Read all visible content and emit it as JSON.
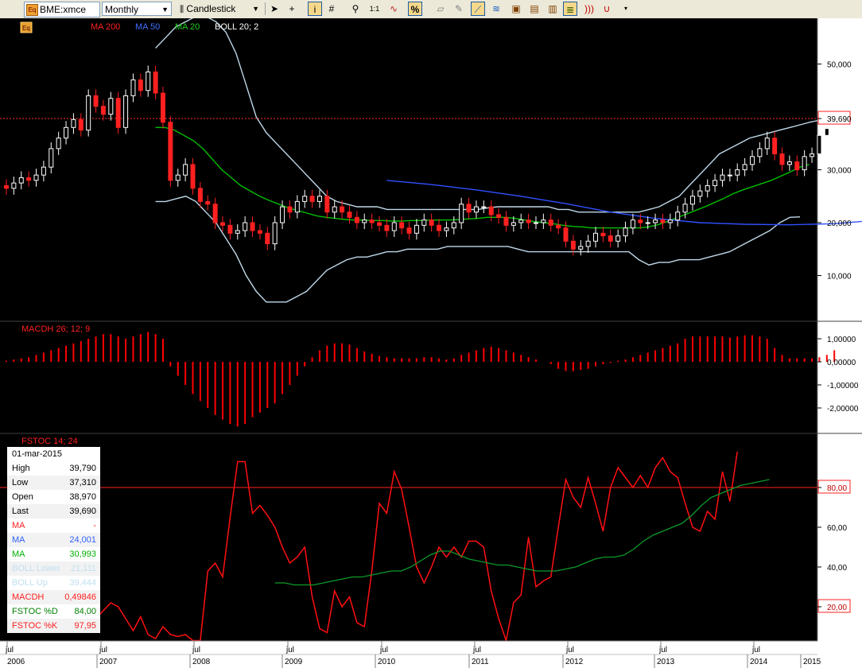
{
  "toolbar": {
    "symbol": "BME:xmce",
    "period": "Monthly",
    "chart_type": "Candlestick",
    "icons": [
      "pointer-icon",
      "crosshair-icon",
      "info-icon",
      "grid-icon",
      "zoom-icon",
      "one-to-one-icon",
      "wave-icon",
      "percent-icon",
      "eraser-icon",
      "pen-icon",
      "line-tool-icon",
      "fibonacci-icon",
      "marker-icon",
      "text-icon",
      "channel-icon",
      "sound-icon",
      "magnet-icon"
    ]
  },
  "legend": {
    "eq_label": "Eq",
    "ma200": "MA 200",
    "ma50": "MA 50",
    "ma20": "MA 20",
    "boll": "BOLL 20; 2",
    "macdh": "MACDH 26; 12; 9",
    "fstoc": "FSTOC 14; 24"
  },
  "colors": {
    "candle_up": "#ffffff",
    "candle_down": "#ff2020",
    "ma50": "#3050ff",
    "ma20": "#00c000",
    "bollinger": "#c0d8e8",
    "macd": "#ff0000",
    "stoch_k": "#ff1010",
    "stoch_d": "#0a9a2a",
    "last_line": "#ff3030"
  },
  "price_axis": [
    "50,000",
    "40,000",
    "30,000",
    "20,000",
    "10,000"
  ],
  "last_price_label": "39,690",
  "macd_axis": [
    "1,00000",
    "0,00000",
    "-1,00000",
    "-2,00000"
  ],
  "stoch_axis": [
    "80,00",
    "60,00",
    "40,00",
    "20,00"
  ],
  "x_axis": {
    "years": [
      "2006",
      "2007",
      "2008",
      "2009",
      "2010",
      "2011",
      "2012",
      "2013",
      "2014",
      "2015"
    ],
    "jul_label": "jul"
  },
  "info": {
    "date": "01-mar-2015",
    "rows": [
      {
        "k": "High",
        "v": "39,790",
        "color": "#000000"
      },
      {
        "k": "Low",
        "v": "37,310",
        "color": "#000000"
      },
      {
        "k": "Open",
        "v": "38,970",
        "color": "#000000"
      },
      {
        "k": "Last",
        "v": "39,690",
        "color": "#000000"
      },
      {
        "k": "MA",
        "v": "-",
        "color": "#ff2020"
      },
      {
        "k": "MA",
        "v": "24,001",
        "color": "#3060ff"
      },
      {
        "k": "MA",
        "v": "30,993",
        "color": "#00b000"
      },
      {
        "k": "BOLL Lower",
        "v": "21,111",
        "color": "#c0e0f0"
      },
      {
        "k": "BOLL Up",
        "v": "39,444",
        "color": "#c0e0f0"
      },
      {
        "k": "MACDH",
        "v": "0,49846",
        "color": "#ff2020"
      },
      {
        "k": "FSTOC %D",
        "v": "84,00",
        "color": "#008000"
      },
      {
        "k": "FSTOC %K",
        "v": "97,95",
        "color": "#ff2020"
      }
    ]
  },
  "chart_data": [
    {
      "type": "candlestick",
      "x_start": "2006-05",
      "frequency": "monthly",
      "close": [
        26.5,
        27.5,
        28.5,
        28.0,
        29.0,
        30.5,
        34.0,
        36.0,
        38.0,
        39.5,
        37.5,
        44.0,
        42.0,
        40.5,
        43.5,
        38.0,
        44.0,
        47.0,
        45.0,
        48.5,
        44.5,
        39.0,
        28.0,
        29.0,
        31.0,
        26.5,
        24.0,
        23.5,
        20.0,
        19.5,
        18.0,
        18.5,
        20.0,
        18.5,
        18.0,
        16.0,
        20.0,
        23.0,
        22.0,
        24.0,
        25.0,
        24.0,
        25.0,
        22.0,
        23.0,
        22.0,
        21.0,
        20.0,
        20.5,
        20.0,
        19.5,
        18.5,
        20.0,
        19.0,
        18.0,
        19.5,
        20.5,
        19.5,
        18.5,
        19.0,
        20.0,
        23.5,
        22.0,
        23.0,
        23.0,
        21.5,
        21.0,
        19.5,
        20.0,
        20.5,
        20.0,
        20.0,
        20.5,
        19.5,
        19.0,
        16.5,
        15.0,
        15.5,
        16.5,
        18.0,
        17.5,
        16.5,
        17.5,
        19.0,
        20.5,
        20.0,
        20.0,
        20.5,
        20.0,
        20.5,
        22.0,
        23.5,
        25.0,
        26.0,
        27.0,
        28.0,
        29.0,
        29.0,
        30.0,
        31.0,
        32.5,
        34.0,
        36.0,
        33.0,
        31.0,
        31.5,
        30.0,
        32.5,
        33.0,
        36.5,
        37.8,
        39.69
      ],
      "open": [
        27.0,
        26.5,
        27.5,
        28.5,
        28.0,
        29.0,
        30.5,
        34.0,
        36.0,
        38.0,
        39.5,
        37.5,
        44.0,
        42.0,
        40.5,
        43.5,
        38.0,
        44.0,
        47.0,
        45.0,
        48.5,
        44.5,
        39.0,
        28.0,
        29.0,
        31.0,
        26.5,
        24.0,
        23.5,
        20.0,
        19.5,
        18.0,
        18.5,
        20.0,
        18.5,
        18.0,
        16.0,
        20.0,
        23.0,
        22.0,
        24.0,
        25.0,
        24.0,
        25.0,
        22.0,
        23.0,
        22.0,
        21.0,
        20.0,
        20.5,
        20.0,
        19.5,
        18.5,
        20.0,
        19.0,
        18.0,
        19.5,
        20.5,
        19.5,
        18.5,
        19.0,
        20.0,
        23.5,
        22.0,
        23.0,
        23.0,
        21.5,
        21.0,
        19.5,
        20.0,
        20.5,
        20.0,
        20.0,
        20.5,
        19.5,
        19.0,
        16.5,
        15.0,
        15.5,
        16.5,
        18.0,
        17.5,
        16.5,
        17.5,
        19.0,
        20.5,
        20.0,
        20.0,
        20.5,
        20.0,
        20.5,
        22.0,
        23.5,
        25.0,
        26.0,
        27.0,
        28.0,
        29.0,
        29.0,
        30.0,
        31.0,
        32.5,
        34.0,
        36.0,
        33.0,
        31.0,
        31.5,
        30.0,
        32.5,
        33.0,
        36.5,
        38.97
      ],
      "ma50": {
        "start_index": 48,
        "values_every_6": [
          28.0,
          27.2,
          26.2,
          25.0,
          23.6,
          22.0,
          20.8,
          20.0,
          19.7,
          19.6,
          19.8,
          20.5,
          21.6,
          22.7,
          23.5,
          24.0
        ]
      },
      "ma20": [
        38,
        38,
        37.5,
        36.5,
        35.5,
        34,
        32,
        30,
        28.5,
        27,
        26,
        25,
        24.2,
        23.5,
        22.8,
        22.3,
        21.8,
        21.3,
        21,
        20.8,
        20.6,
        20.5,
        20.5,
        20.4,
        20.4,
        20.3,
        20.3,
        20.4,
        20.4,
        20.5,
        20.5,
        20.5,
        20.6,
        20.7,
        20.8,
        21,
        21.0,
        21.0,
        20.8,
        20.5,
        20.2,
        20.0,
        19.8,
        19.5,
        19.3,
        19.2,
        19.0,
        19.0,
        19.0,
        19.0,
        19.0,
        19.0,
        19.2,
        19.6,
        20.2,
        20.9,
        21.6,
        22.3,
        23.0,
        23.8,
        24.6,
        25.5,
        26.2,
        26.8,
        27.4,
        28.0,
        28.8,
        29.6,
        30.5,
        31.0
      ],
      "boll_upper": [
        53,
        55,
        57,
        58,
        59,
        59,
        58,
        56,
        52,
        46,
        40,
        37,
        35,
        33,
        31,
        29,
        27,
        25,
        24,
        23.5,
        23,
        23,
        23,
        22.5,
        22.5,
        22.5,
        22.5,
        22.5,
        22.5,
        22.5,
        22.5,
        22.5,
        22.5,
        22.8,
        23,
        23,
        23,
        23,
        23,
        23,
        22.5,
        22.5,
        22,
        22,
        22,
        22,
        22,
        22,
        22,
        22.5,
        23,
        24,
        25,
        27,
        29,
        31,
        33,
        34,
        35,
        36,
        36.5,
        37,
        37.5,
        38,
        38.5,
        39,
        39.4
      ],
      "boll_lower": [
        24,
        24,
        24.5,
        25,
        24,
        22,
        20,
        17,
        14,
        10,
        7,
        5,
        5,
        5,
        6,
        7,
        9,
        11,
        12,
        13,
        13.5,
        13.5,
        14,
        14.5,
        14.5,
        15,
        15,
        15,
        15,
        15.5,
        15.5,
        15.5,
        15.5,
        15.5,
        15.5,
        15.5,
        15,
        14.5,
        14.5,
        14.5,
        14.5,
        14.5,
        14.5,
        14.5,
        14.5,
        14.5,
        14.5,
        14.5,
        13,
        12,
        12.5,
        12.5,
        13,
        13,
        13,
        13.5,
        14,
        14.5,
        15.5,
        16.5,
        17.5,
        18.5,
        20,
        21,
        21.1
      ],
      "ylim": [
        0,
        55
      ],
      "last": 39.69
    },
    {
      "type": "bar",
      "title": "MACDH 26; 12; 9",
      "values": [
        0.05,
        0.1,
        0.15,
        0.2,
        0.3,
        0.4,
        0.5,
        0.6,
        0.7,
        0.8,
        0.9,
        1.0,
        1.1,
        1.2,
        1.2,
        1.1,
        1.0,
        1.1,
        1.2,
        1.3,
        1.2,
        1.0,
        -0.2,
        -0.6,
        -1.0,
        -1.4,
        -1.7,
        -2.0,
        -2.3,
        -2.5,
        -2.7,
        -2.8,
        -2.7,
        -2.4,
        -2.2,
        -2.0,
        -1.8,
        -1.4,
        -1.0,
        -0.6,
        -0.2,
        0.2,
        0.5,
        0.7,
        0.8,
        0.8,
        0.75,
        0.6,
        0.45,
        0.35,
        0.25,
        0.2,
        0.15,
        0.15,
        0.15,
        0.15,
        0.2,
        0.2,
        0.15,
        0.1,
        0.15,
        0.3,
        0.4,
        0.5,
        0.6,
        0.65,
        0.6,
        0.5,
        0.4,
        0.3,
        0.2,
        0.1,
        0.0,
        -0.1,
        -0.3,
        -0.4,
        -0.4,
        -0.35,
        -0.3,
        -0.2,
        -0.1,
        -0.05,
        0.05,
        0.1,
        0.2,
        0.3,
        0.4,
        0.5,
        0.6,
        0.7,
        0.8,
        1.0,
        1.1,
        1.1,
        1.1,
        1.1,
        1.1,
        1.05,
        1.1,
        1.15,
        1.15,
        1.1,
        1.0,
        0.6,
        0.3,
        0.15,
        0.15,
        0.15,
        0.15,
        0.2,
        0.3,
        0.5
      ],
      "ylim": [
        -3,
        1.7
      ]
    },
    {
      "type": "line",
      "title": "FSTOC 14; 24",
      "k": [
        78,
        93,
        90,
        89,
        87,
        62,
        14,
        18,
        22,
        20,
        14,
        8,
        15,
        6,
        4,
        10,
        6,
        5,
        6,
        3,
        3,
        38,
        42,
        35,
        65,
        93,
        93,
        67,
        71,
        66,
        60,
        50,
        42,
        45,
        50,
        25,
        9,
        7,
        28,
        20,
        25,
        12,
        10,
        38,
        72,
        67,
        88,
        79,
        60,
        40,
        32,
        40,
        50,
        45,
        50,
        45,
        53,
        53,
        50,
        28,
        14,
        3,
        22,
        26,
        55,
        30,
        33,
        35,
        60,
        84,
        75,
        70,
        85,
        72,
        58,
        80,
        90,
        85,
        80,
        86,
        80,
        90,
        95,
        88,
        85,
        72,
        60,
        58,
        68,
        64,
        88,
        73,
        97.95
      ],
      "d": [
        32,
        32,
        31,
        31,
        31,
        32,
        33,
        34,
        35,
        35,
        36,
        37,
        38,
        38,
        40,
        43,
        46,
        48,
        48,
        46,
        44,
        43,
        42,
        41,
        41,
        40,
        39,
        38,
        38,
        38,
        39,
        40,
        42,
        44,
        45,
        45,
        46,
        49,
        53,
        56,
        58,
        60,
        62,
        66,
        71,
        75,
        77,
        79,
        81,
        82,
        83,
        84
      ],
      "d_start_index": 20,
      "ylim": [
        0,
        100
      ],
      "level": 80
    }
  ]
}
